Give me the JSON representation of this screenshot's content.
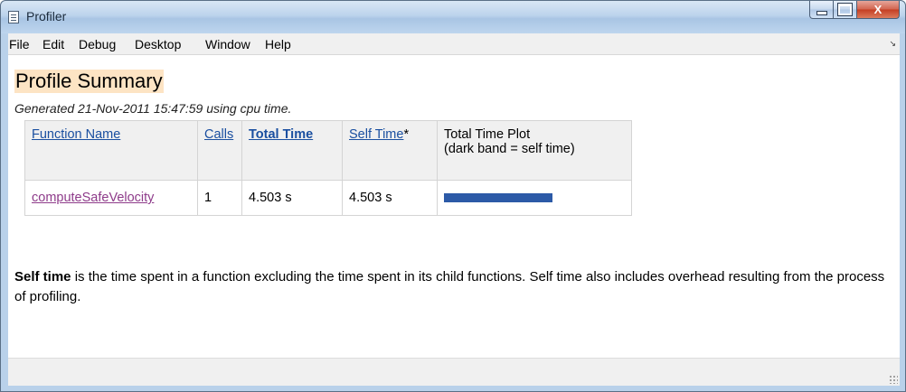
{
  "window": {
    "title": "Profiler"
  },
  "menu": [
    "File",
    "Edit",
    "Debug",
    "Desktop",
    "Window",
    "Help"
  ],
  "page": {
    "title": "Profile Summary",
    "subtitle": "Generated 21-Nov-2011 15:47:59 using cpu time."
  },
  "table": {
    "headers": {
      "function_name": "Function Name",
      "calls": "Calls",
      "total_time": "Total Time",
      "self_time": "Self Time",
      "self_time_mark": "*",
      "plot_line1": "Total Time Plot",
      "plot_line2": "(dark band = self time)"
    },
    "rows": [
      {
        "function_name": "computeSafeVelocity",
        "calls": "1",
        "total_time": "4.503 s",
        "self_time": "4.503 s",
        "self_time_fraction": 1.0
      }
    ],
    "bar_color": "#2c5aa7"
  },
  "note": {
    "bold": "Self time",
    "text": " is the time spent in a function excluding the time spent in its child functions. Self time also includes overhead resulting from the process of profiling."
  },
  "controls": {
    "close_glyph": "X",
    "corner_glyph": "↘"
  }
}
